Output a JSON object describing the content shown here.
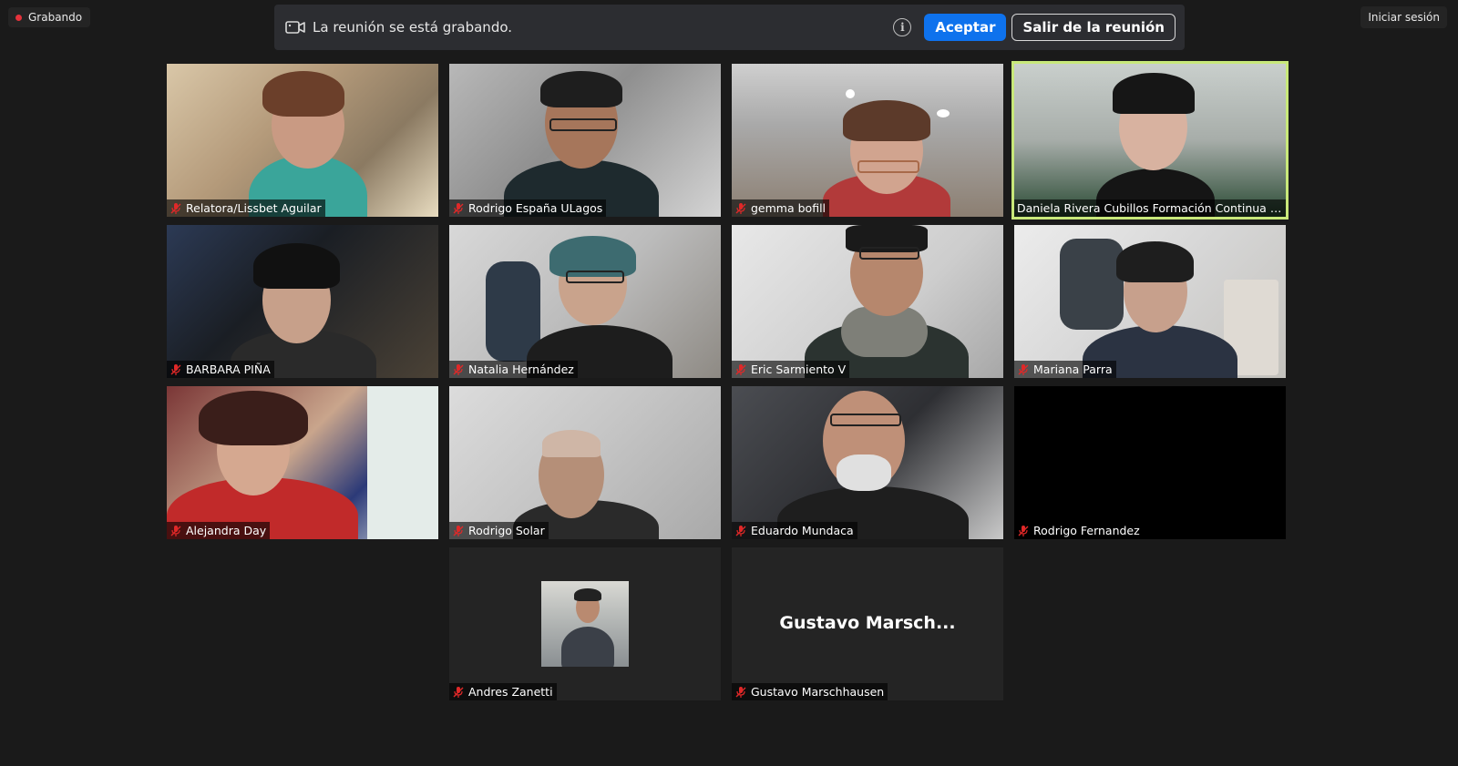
{
  "recording_badge": {
    "label": "Grabando",
    "dot_color": "#e5323b"
  },
  "signin": {
    "label": "Iniciar sesión"
  },
  "banner": {
    "message": "La reunión se está grabando.",
    "accept_label": "Aceptar",
    "leave_label": "Salir de la reunión",
    "icons": [
      "video-camera-icon",
      "info-icon"
    ],
    "accent_color": "#0e72ed"
  },
  "participants": [
    {
      "name": "Relatora/Lissbet Aguilar",
      "muted": true
    },
    {
      "name": "Rodrigo España  ULagos",
      "muted": true
    },
    {
      "name": "gemma bofill",
      "muted": true
    },
    {
      "name": "Daniela Rivera Cubillos Formación Continua ULA...",
      "muted": false,
      "active_speaker": true,
      "highlight_color": "#c8e87a"
    },
    {
      "name": "BARBARA PIÑA",
      "muted": true
    },
    {
      "name": "Natalia Hernández",
      "muted": true
    },
    {
      "name": "Eric Sarmiento V",
      "muted": true
    },
    {
      "name": "Mariana Parra",
      "muted": true
    },
    {
      "name": "Alejandra Day",
      "muted": true
    },
    {
      "name": "Rodrigo Solar",
      "muted": true
    },
    {
      "name": "Eduardo Mundaca",
      "muted": true
    },
    {
      "name": "Rodrigo Fernandez",
      "muted": true,
      "video_off": true
    },
    {
      "name": "Andres Zanetti",
      "muted": true,
      "video_off": true,
      "has_avatar": true
    },
    {
      "name": "Gustavo Marschhausen",
      "muted": true,
      "video_off": true,
      "display_name_short": "Gustavo  Marsch..."
    }
  ]
}
